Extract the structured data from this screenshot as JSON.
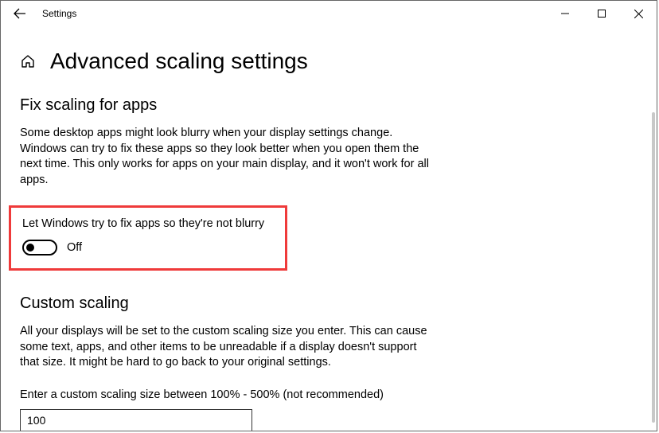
{
  "window": {
    "title": "Settings"
  },
  "page": {
    "title": "Advanced scaling settings"
  },
  "fix_scaling": {
    "heading": "Fix scaling for apps",
    "body": "Some desktop apps might look blurry when your display settings change. Windows can try to fix these apps so they look better when you open them the next time. This only works for apps on your main display, and it won't work for all apps.",
    "toggle_label": "Let Windows try to fix apps so they're not blurry",
    "toggle_state": "Off"
  },
  "custom_scaling": {
    "heading": "Custom scaling",
    "body": "All your displays will be set to the custom scaling size you enter. This can cause some text, apps, and other items to be unreadable if a display doesn't support that size. It might be hard to go back to your original settings.",
    "input_label": "Enter a custom scaling size between 100% - 500% (not recommended)",
    "input_value": "100"
  }
}
